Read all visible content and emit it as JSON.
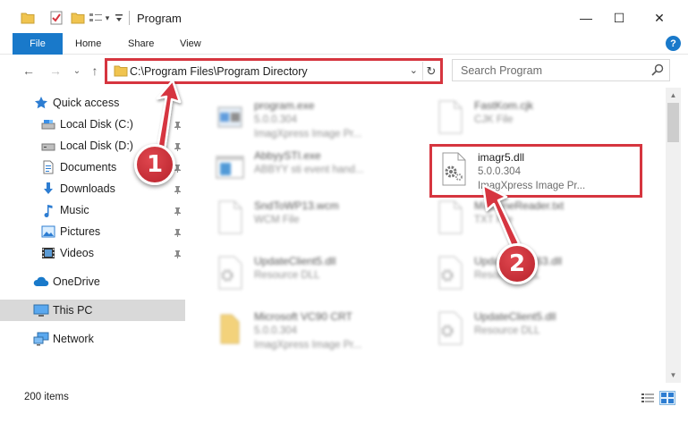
{
  "window": {
    "title": "Program",
    "minimize_glyph": "—",
    "maximize_glyph": "☐",
    "close_glyph": "✕"
  },
  "ribbon": {
    "tabs": [
      "File",
      "Home",
      "Share",
      "View"
    ],
    "help_glyph": "?"
  },
  "nav": {
    "back_glyph": "←",
    "forward_glyph": "→",
    "recent_glyph": "⌄",
    "up_glyph": "↑",
    "address": "C:\\Program Files\\Program Directory",
    "dropdown_glyph": "⌄",
    "refresh_glyph": "↻",
    "search_placeholder": "Search Program"
  },
  "sidebar": {
    "items": [
      {
        "label": "Quick access",
        "icon": "star-icon"
      },
      {
        "label": "Local Disk (C:)",
        "icon": "drive-icon"
      },
      {
        "label": "Local Disk (D:)",
        "icon": "drive-icon"
      },
      {
        "label": "Documents",
        "icon": "documents-icon"
      },
      {
        "label": "Downloads",
        "icon": "download-icon"
      },
      {
        "label": "Music",
        "icon": "music-icon"
      },
      {
        "label": "Pictures",
        "icon": "pictures-icon"
      },
      {
        "label": "Videos",
        "icon": "videos-icon"
      },
      {
        "label": "OneDrive",
        "icon": "cloud-icon"
      },
      {
        "label": "This PC",
        "icon": "computer-icon"
      },
      {
        "label": "Network",
        "icon": "network-icon"
      }
    ]
  },
  "files": [
    {
      "name": "program.exe",
      "line1": "5.0.0.304",
      "line2": "ImagXpress Image Pr...",
      "icon": "exe-icon"
    },
    {
      "name": "FastKom.cjk",
      "line1": "CJK File",
      "line2": "",
      "icon": "file-icon"
    },
    {
      "name": "AbbyySTI.exe",
      "line1": "ABBYY sti event hand...",
      "line2": "",
      "icon": "window-exe-icon"
    },
    {
      "name": "imagr5.dll",
      "line1": "5.0.0.304",
      "line2": "ImagXpress Image Pr...",
      "icon": "dll-gear-icon"
    },
    {
      "name": "SndToWP13.wcm",
      "line1": "WCM File",
      "line2": "",
      "icon": "file-icon"
    },
    {
      "name": "MachineReader.txt",
      "line1": "TXT File",
      "line2": "",
      "icon": "file-icon"
    },
    {
      "name": "UpdateClient5.dll",
      "line1": "Resource DLL",
      "line2": "",
      "icon": "dll-gear-icon"
    },
    {
      "name": "UpdateClient63.dll",
      "line1": "Resource DLL",
      "line2": "",
      "icon": "dll-gear-icon"
    },
    {
      "name": "Microsoft VC90 CRT",
      "line1": "5.0.0.304",
      "line2": "ImagXpress Image Pr...",
      "icon": "folder-icon"
    },
    {
      "name": "UpdateClient5.dll",
      "line1": "Resource DLL",
      "line2": "",
      "icon": "dll-gear-icon"
    }
  ],
  "status": {
    "item_count": "200 items"
  },
  "annotations": {
    "step1": "1",
    "step2": "2"
  },
  "colors": {
    "accent": "#1979ca",
    "highlight": "#d6353f",
    "selected": "#d9d9d9"
  }
}
